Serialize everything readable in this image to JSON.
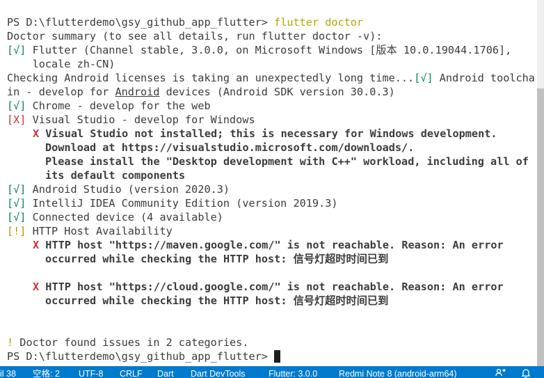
{
  "terminal": {
    "top_partial": "                                              ",
    "lines": [
      {
        "prompt": "PS D:\\flutterdemo\\gsy_github_app_flutter> ",
        "command": "flutter doctor"
      },
      {
        "text": "Doctor summary (to see all details, run flutter doctor -v):"
      },
      {
        "mark": "[√]",
        "text": " Flutter (Channel stable, 3.0.0, on Microsoft Windows [版本 10.0.19044.1706],"
      },
      {
        "text": "    locale zh-CN)"
      },
      {
        "text_a": "Checking Android licenses is taking an unexpectedly long time...",
        "mark": "[√]",
        "text_b": " Android toolcha"
      },
      {
        "text_a": "in - develop for ",
        "link": "Android",
        "text_b": " devices (Android SDK version 30.0.3)"
      },
      {
        "mark": "[√]",
        "text": " Chrome - develop for the web"
      },
      {
        "mark": "[X]",
        "text": " Visual Studio - develop for Windows"
      },
      {
        "mark": "X",
        "text": " Visual Studio not installed; this is necessary for Windows development."
      },
      {
        "text": "Download at https://visualstudio.microsoft.com/downloads/."
      },
      {
        "text": "Please install the \"Desktop development with C++\" workload, including all of"
      },
      {
        "text": "its default components"
      },
      {
        "mark": "[√]",
        "text": " Android Studio (version 2020.3)"
      },
      {
        "mark": "[√]",
        "text": " IntelliJ IDEA Community Edition (version 2019.3)"
      },
      {
        "mark": "[√]",
        "text": " Connected device (4 available)"
      },
      {
        "mark": "[!]",
        "text": " HTTP Host Availability"
      },
      {
        "mark": "X",
        "text": " HTTP host \"https://maven.google.com/\" is not reachable. Reason: An error"
      },
      {
        "text": "occurred while checking the HTTP host: 信号灯超时时间已到"
      },
      {
        "text": ""
      },
      {
        "mark": "X",
        "text": " HTTP host \"https://cloud.google.com/\" is not reachable. Reason: An error"
      },
      {
        "text": "occurred while checking the HTTP host: 信号灯超时时间已到"
      },
      {
        "text": ""
      },
      {
        "text": ""
      },
      {
        "mark": "!",
        "text": " Doctor found issues in 2 categories."
      },
      {
        "prompt": "PS D:\\flutterdemo\\gsy_github_app_flutter> "
      }
    ]
  },
  "statusbar": {
    "line_col": "il 38",
    "spaces": "空格: 2",
    "encoding": "UTF-8",
    "eol": "CRLF",
    "language": "Dart",
    "devtools": "Dart DevTools",
    "flutter": "Flutter: 3.0.0",
    "device": "Redmi Note 8 (android-arm64)",
    "share_icon": "live-share-icon",
    "bell_icon": "notification-bell-icon"
  },
  "colors": {
    "statusbar_bg": "#007acc",
    "ok_green": "#098658",
    "error_red": "#cd3131",
    "warn_yellow": "#b89500",
    "command_yellow": "#b5a700"
  }
}
